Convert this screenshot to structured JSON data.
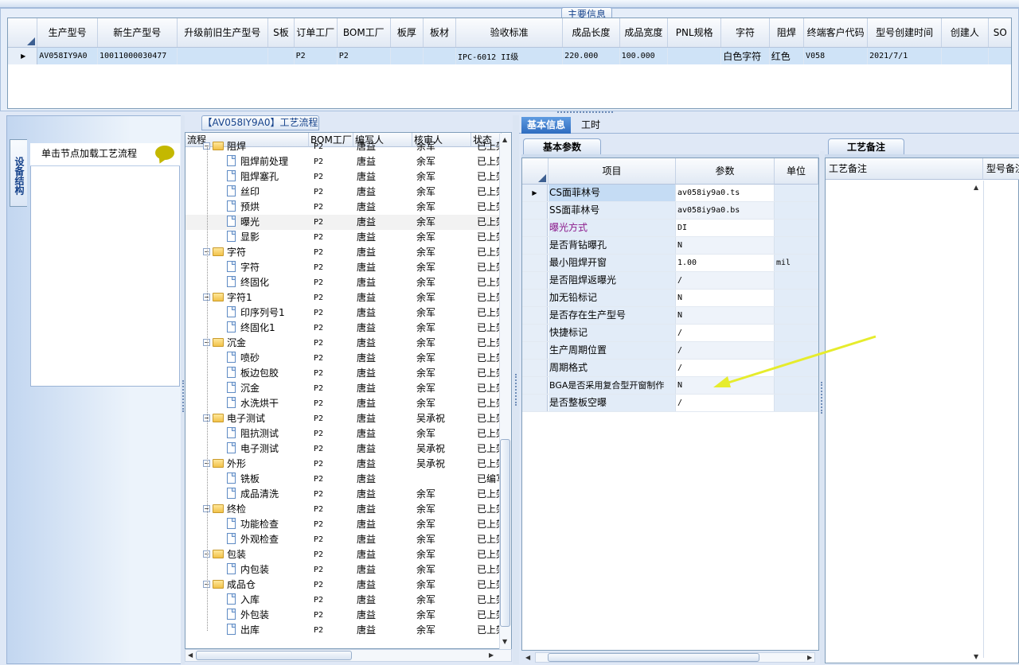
{
  "main": {
    "caption": "主要信息",
    "columns": [
      "生产型号",
      "新生产型号",
      "升级前旧生产型号",
      "S板",
      "订单工厂",
      "BOM工厂",
      "板厚",
      "板材",
      "验收标准",
      "成品长度",
      "成品宽度",
      "PNL规格",
      "字符",
      "阻焊",
      "终端客户代码",
      "型号创建时间",
      "创建人",
      "SO"
    ],
    "row": [
      "AV058IY9A0",
      "10011000030477",
      "",
      "",
      "P2",
      "P2",
      "",
      "",
      "IPC-6012 II级",
      "220.000",
      "100.000",
      "",
      "白色字符",
      "红色",
      "V058",
      "2021/7/1",
      "",
      ""
    ]
  },
  "left": {
    "vertical_tab": "设备结构",
    "hint": "单击节点加载工艺流程"
  },
  "tree": {
    "caption": "【AV058IY9A0】工艺流程",
    "headers": [
      "流程",
      "BOM工厂",
      "编写人",
      "核审人",
      "状态"
    ],
    "rows": [
      {
        "level": 1,
        "name": "阻焊",
        "bom": "P2",
        "writer": "唐益",
        "checker": "余军",
        "status": "已上架",
        "type": "folder"
      },
      {
        "level": 2,
        "name": "阻焊前处理",
        "bom": "P2",
        "writer": "唐益",
        "checker": "余军",
        "status": "已上架"
      },
      {
        "level": 2,
        "name": "阻焊塞孔",
        "bom": "P2",
        "writer": "唐益",
        "checker": "余军",
        "status": "已上架"
      },
      {
        "level": 2,
        "name": "丝印",
        "bom": "P2",
        "writer": "唐益",
        "checker": "余军",
        "status": "已上架"
      },
      {
        "level": 2,
        "name": "预烘",
        "bom": "P2",
        "writer": "唐益",
        "checker": "余军",
        "status": "已上架"
      },
      {
        "level": 2,
        "name": "曝光",
        "bom": "P2",
        "writer": "唐益",
        "checker": "余军",
        "status": "已上架",
        "selected": true
      },
      {
        "level": 2,
        "name": "显影",
        "bom": "P2",
        "writer": "唐益",
        "checker": "余军",
        "status": "已上架"
      },
      {
        "level": 1,
        "name": "字符",
        "bom": "P2",
        "writer": "唐益",
        "checker": "余军",
        "status": "已上架"
      },
      {
        "level": 2,
        "name": "字符",
        "bom": "P2",
        "writer": "唐益",
        "checker": "余军",
        "status": "已上架"
      },
      {
        "level": 2,
        "name": "终固化",
        "bom": "P2",
        "writer": "唐益",
        "checker": "余军",
        "status": "已上架"
      },
      {
        "level": 1,
        "name": "字符1",
        "bom": "P2",
        "writer": "唐益",
        "checker": "余军",
        "status": "已上架"
      },
      {
        "level": 2,
        "name": "印序列号1",
        "bom": "P2",
        "writer": "唐益",
        "checker": "余军",
        "status": "已上架"
      },
      {
        "level": 2,
        "name": "终固化1",
        "bom": "P2",
        "writer": "唐益",
        "checker": "余军",
        "status": "已上架"
      },
      {
        "level": 1,
        "name": "沉金",
        "bom": "P2",
        "writer": "唐益",
        "checker": "余军",
        "status": "已上架"
      },
      {
        "level": 2,
        "name": "喷砂",
        "bom": "P2",
        "writer": "唐益",
        "checker": "余军",
        "status": "已上架"
      },
      {
        "level": 2,
        "name": "板边包胶",
        "bom": "P2",
        "writer": "唐益",
        "checker": "余军",
        "status": "已上架"
      },
      {
        "level": 2,
        "name": "沉金",
        "bom": "P2",
        "writer": "唐益",
        "checker": "余军",
        "status": "已上架"
      },
      {
        "level": 2,
        "name": "水洗烘干",
        "bom": "P2",
        "writer": "唐益",
        "checker": "余军",
        "status": "已上架"
      },
      {
        "level": 1,
        "name": "电子测试",
        "bom": "P2",
        "writer": "唐益",
        "checker": "吴承祝",
        "status": "已上架"
      },
      {
        "level": 2,
        "name": "阻抗测试",
        "bom": "P2",
        "writer": "唐益",
        "checker": "余军",
        "status": "已上架"
      },
      {
        "level": 2,
        "name": "电子测试",
        "bom": "P2",
        "writer": "唐益",
        "checker": "吴承祝",
        "status": "已上架"
      },
      {
        "level": 1,
        "name": "外形",
        "bom": "P2",
        "writer": "唐益",
        "checker": "吴承祝",
        "status": "已上架"
      },
      {
        "level": 2,
        "name": "铣板",
        "bom": "P2",
        "writer": "唐益",
        "checker": "",
        "status": "已编写"
      },
      {
        "level": 2,
        "name": "成品清洗",
        "bom": "P2",
        "writer": "唐益",
        "checker": "余军",
        "status": "已上架"
      },
      {
        "level": 1,
        "name": "终检",
        "bom": "P2",
        "writer": "唐益",
        "checker": "余军",
        "status": "已上架"
      },
      {
        "level": 2,
        "name": "功能检查",
        "bom": "P2",
        "writer": "唐益",
        "checker": "余军",
        "status": "已上架"
      },
      {
        "level": 2,
        "name": "外观检查",
        "bom": "P2",
        "writer": "唐益",
        "checker": "余军",
        "status": "已上架"
      },
      {
        "level": 1,
        "name": "包装",
        "bom": "P2",
        "writer": "唐益",
        "checker": "余军",
        "status": "已上架"
      },
      {
        "level": 2,
        "name": "内包装",
        "bom": "P2",
        "writer": "唐益",
        "checker": "余军",
        "status": "已上架"
      },
      {
        "level": 1,
        "name": "成品仓",
        "bom": "P2",
        "writer": "唐益",
        "checker": "余军",
        "status": "已上架"
      },
      {
        "level": 2,
        "name": "入库",
        "bom": "P2",
        "writer": "唐益",
        "checker": "余军",
        "status": "已上架"
      },
      {
        "level": 2,
        "name": "外包装",
        "bom": "P2",
        "writer": "唐益",
        "checker": "余军",
        "status": "已上架"
      },
      {
        "level": 2,
        "name": "出库",
        "bom": "P2",
        "writer": "唐益",
        "checker": "余军",
        "status": "已上架"
      }
    ]
  },
  "detail": {
    "tabs": [
      "基本信息",
      "工时"
    ],
    "subtab": "基本参数",
    "headers": [
      "项目",
      "参数",
      "单位"
    ],
    "rows": [
      {
        "item": "CS面菲林号",
        "value": "av058iy9a0.ts",
        "unit": ""
      },
      {
        "item": "SS面菲林号",
        "value": "av058iy9a0.bs",
        "unit": ""
      },
      {
        "item": "曝光方式",
        "value": "DI",
        "unit": "",
        "highlight": true
      },
      {
        "item": "是否背钻曝孔",
        "value": "N",
        "unit": ""
      },
      {
        "item": "最小阻焊开窗",
        "value": "1.00",
        "unit": "mil"
      },
      {
        "item": "是否阻焊返曝光",
        "value": "/",
        "unit": ""
      },
      {
        "item": "加无铅标记",
        "value": "N",
        "unit": ""
      },
      {
        "item": "是否存在生产型号",
        "value": "N",
        "unit": ""
      },
      {
        "item": "快捷标记",
        "value": "/",
        "unit": ""
      },
      {
        "item": "生产周期位置",
        "value": "/",
        "unit": ""
      },
      {
        "item": "周期格式",
        "value": "/",
        "unit": ""
      },
      {
        "item": "BGA是否采用复合型开窗制作",
        "value": "N",
        "unit": ""
      },
      {
        "item": "是否整板空曝",
        "value": "/",
        "unit": ""
      }
    ],
    "highlight_color": "#8b1a8b"
  },
  "remark": {
    "tab": "工艺备注",
    "headers": [
      "工艺备注",
      "型号备注"
    ]
  },
  "colors": {
    "accent": "#2e6cc0",
    "arrow": "#e6ec2c",
    "selection": "#cfe3f7"
  }
}
